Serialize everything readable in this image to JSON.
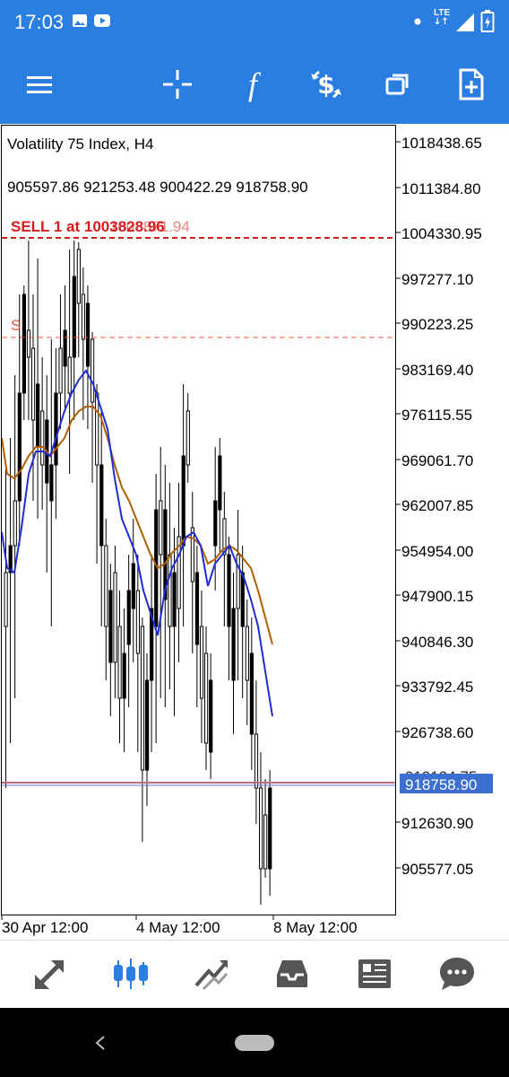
{
  "status_bar": {
    "time": "17:03",
    "network": "LTE",
    "icons": [
      "image-icon",
      "youtube-icon",
      "dot-icon",
      "signal-icon",
      "battery-icon"
    ]
  },
  "toolbar": {
    "items": [
      {
        "name": "menu-button",
        "icon": "hamburger-icon"
      },
      {
        "name": "crosshair-button",
        "icon": "crosshair-icon"
      },
      {
        "name": "indicators-button",
        "icon": "function-icon",
        "glyph": "f"
      },
      {
        "name": "trade-button",
        "icon": "dollar-cycle-icon",
        "glyph": "$"
      },
      {
        "name": "windows-button",
        "icon": "windows-icon"
      },
      {
        "name": "new-order-button",
        "icon": "new-document-icon"
      }
    ]
  },
  "chart": {
    "symbol_label": "Volatility 75 Index, H4",
    "ohlc_label": "905597.86 921253.48 900422.29 918758.90",
    "order_label": "SELL 1 at 1003828.96",
    "order_label_overlap": "1003871.94",
    "sl_marker": "S",
    "current_price": "918758.90",
    "hidden_price_label": "919194.75",
    "colors": {
      "order_line": "#d81b1b",
      "sl_line": "#e8553b",
      "ma_fast": "#1f2bd6",
      "ma_slow": "#b35e00",
      "price_line": "#c06a88",
      "bid_line": "#6f74d8",
      "price_tag_bg": "#3b6fd1"
    },
    "price_axis": [
      "1018438.65",
      "1011384.80",
      "1004330.95",
      "997277.10",
      "990223.25",
      "983169.40",
      "976115.55",
      "969061.70",
      "962007.85",
      "954954.00",
      "947900.15",
      "940846.30",
      "933792.45",
      "926738.60",
      "912630.90",
      "905577.05"
    ],
    "time_axis": [
      "30 Apr 12:00",
      "4 May 12:00",
      "8 May 12:00"
    ]
  },
  "tab_bar": {
    "items": [
      {
        "name": "tab-quotes",
        "icon": "quotes-arrows-icon",
        "active": false
      },
      {
        "name": "tab-chart",
        "icon": "candlestick-icon",
        "active": true
      },
      {
        "name": "tab-trade",
        "icon": "trend-icon",
        "active": false
      },
      {
        "name": "tab-history",
        "icon": "inbox-icon",
        "active": false
      },
      {
        "name": "tab-news",
        "icon": "newspaper-icon",
        "active": false
      },
      {
        "name": "tab-messages",
        "icon": "chat-icon",
        "active": false
      }
    ]
  }
}
